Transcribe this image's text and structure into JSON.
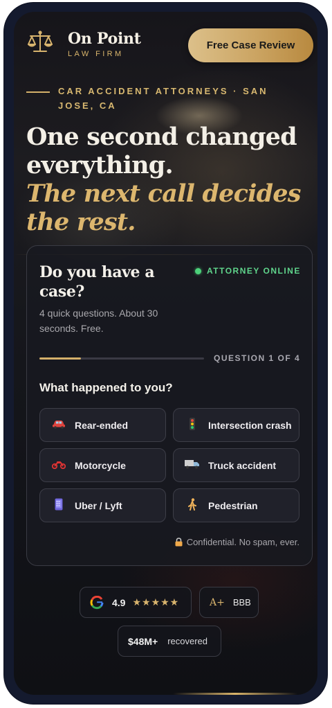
{
  "brand": {
    "name": "On Point",
    "subtitle": "LAW FIRM",
    "icon": "scales-of-justice-icon",
    "accent": "#d8b46e"
  },
  "header": {
    "cta_label": "Free Case Review"
  },
  "hero": {
    "eyebrow": "CAR ACCIDENT ATTORNEYS · SAN JOSE, CA",
    "headline": "One second changed everything.",
    "headline_accent": "The next call decides the rest."
  },
  "card": {
    "title": "Do you have a case?",
    "status": "ATTORNEY ONLINE",
    "status_color": "#4cd17a",
    "subtitle": "4 quick questions. About 30 seconds. Free.",
    "progress": {
      "label": "QUESTION 1 OF 4",
      "current": 1,
      "total": 4,
      "fill_fraction": 0.25
    },
    "question": "What happened to you?",
    "options": [
      {
        "label": "Rear-ended",
        "icon": "car-icon"
      },
      {
        "label": "Intersection crash",
        "icon": "traffic-light-icon"
      },
      {
        "label": "Motorcycle",
        "icon": "motorcycle-icon"
      },
      {
        "label": "Truck accident",
        "icon": "truck-icon"
      },
      {
        "label": "Uber / Lyft",
        "icon": "phone-icon"
      },
      {
        "label": "Pedestrian",
        "icon": "pedestrian-icon"
      }
    ],
    "confidential": "Confidential. No spam, ever."
  },
  "trust": {
    "google": {
      "rating": "4.9",
      "stars": "★★★★★",
      "icon": "google-icon"
    },
    "bbb": {
      "grade": "A+",
      "label": "BBB"
    },
    "recovered": {
      "amount": "$48M+",
      "label": "recovered"
    }
  }
}
